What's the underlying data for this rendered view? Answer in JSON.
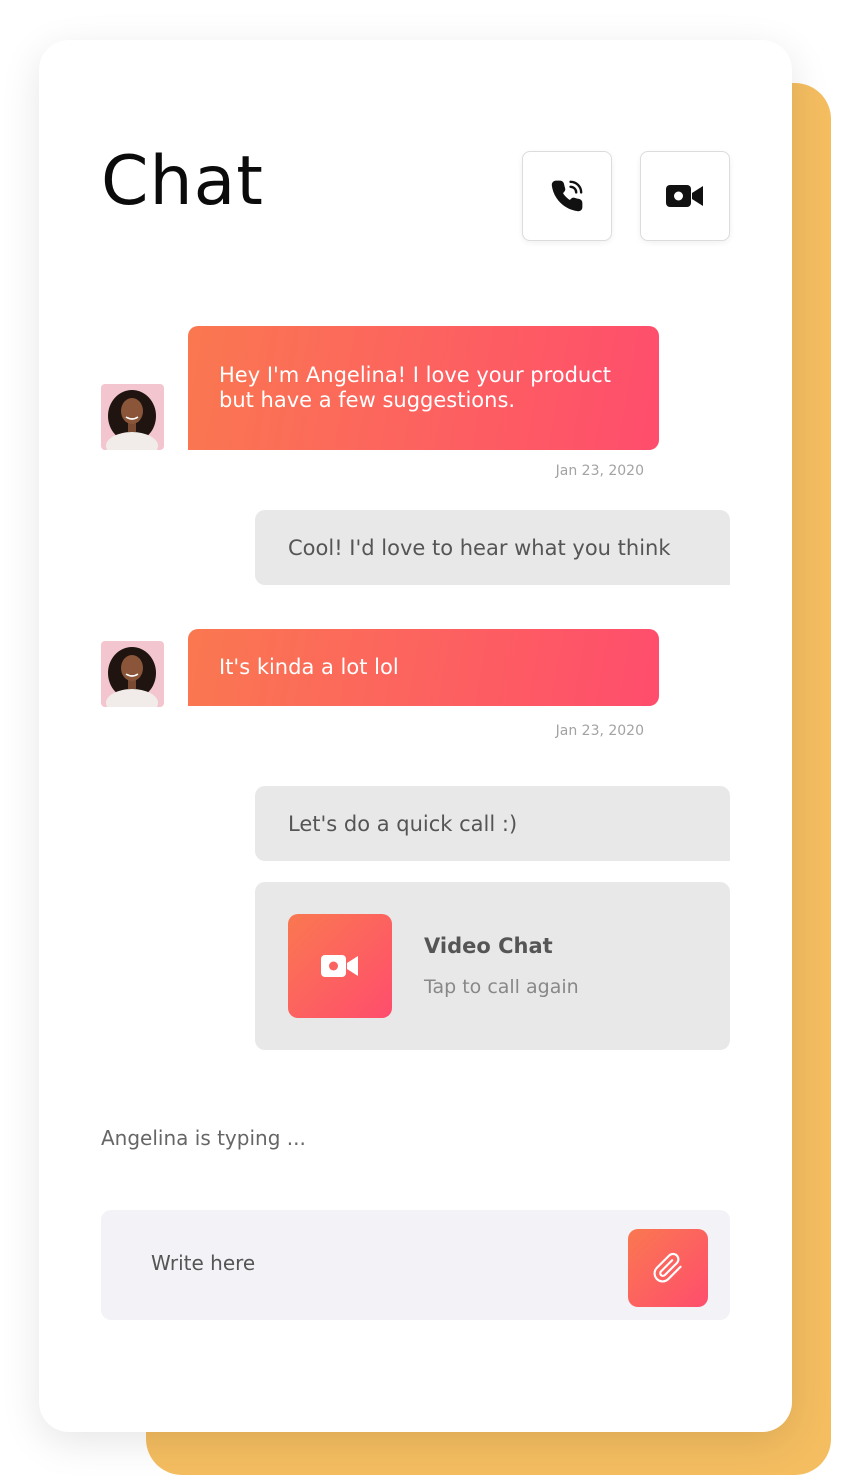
{
  "header": {
    "title": "Chat",
    "call_icon": "phone-ringing-icon",
    "video_icon": "video-camera-icon"
  },
  "messages": [
    {
      "from": "Angelina",
      "text": "Hey I'm Angelina! I love your product\nbut have a few suggestions.",
      "timestamp": "Jan 23, 2020"
    },
    {
      "from": "me",
      "text": "Cool! I'd love to hear what you think"
    },
    {
      "from": "Angelina",
      "text": "It's kinda a lot lol",
      "timestamp": "Jan 23, 2020"
    },
    {
      "from": "me",
      "text": "Let's do a quick call :)"
    }
  ],
  "video_call_card": {
    "title": "Video Chat",
    "subtitle": "Tap to call again",
    "icon": "video-camera-icon"
  },
  "typing_indicator": "Angelina is typing ...",
  "composer": {
    "placeholder": "Write here",
    "attach_icon": "paperclip-icon"
  },
  "colors": {
    "accent_start": "#fa7850",
    "accent_end": "#ff4d6d",
    "backdrop": "#f4bd60",
    "outgoing_bubble": "#e8e8e8",
    "composer_bg": "#f3f3f7"
  }
}
